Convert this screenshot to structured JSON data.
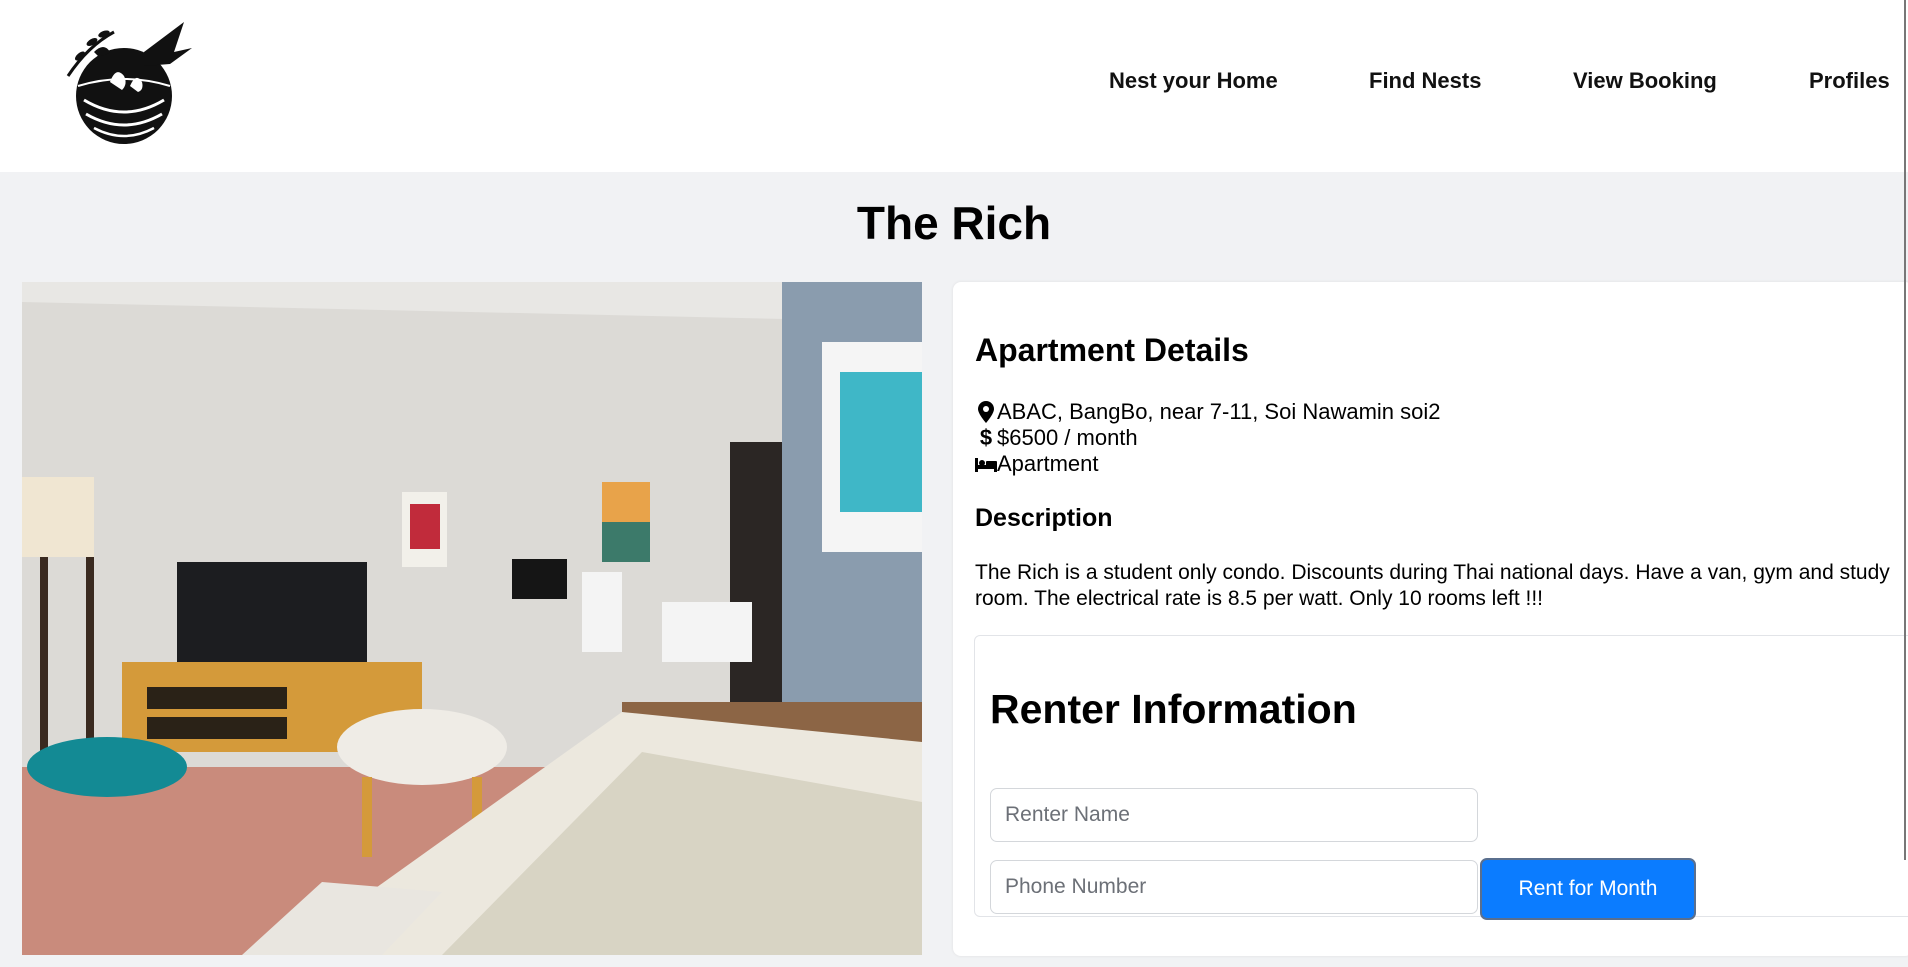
{
  "nav": {
    "logo_icon": "bird-nest-logo",
    "links": [
      "Nest your Home",
      "Find Nests",
      "View Booking",
      "Profiles"
    ]
  },
  "page": {
    "title": "The Rich"
  },
  "photo": {
    "icon": "apartment-living-room-photo"
  },
  "details": {
    "title": "Apartment Details",
    "location": "ABAC, BangBo, near 7-11, Soi Nawamin soi2",
    "price": "$6500 / month",
    "type": "Apartment",
    "description_title": "Description",
    "description": "The Rich is a student only condo. Discounts during Thai national days. Have a van, gym and study room. The electrical rate is 8.5 per watt. Only 10 rooms left !!!"
  },
  "renter": {
    "title": "Renter Information",
    "name_placeholder": "Renter Name",
    "phone_placeholder": "Phone Number",
    "submit_label": "Rent for Month"
  },
  "colors": {
    "accent": "#0b7cff",
    "background": "#f1f2f4"
  }
}
